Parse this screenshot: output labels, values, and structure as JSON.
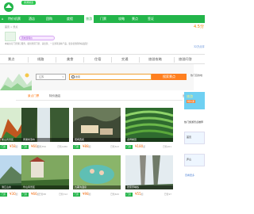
{
  "top": {
    "pill": "旅游频道"
  },
  "nav": [
    "特价机票",
    "酒店",
    "团购",
    "度假",
    "旅游",
    "门票",
    "攻略",
    "景点",
    "签证"
  ],
  "breadcrumb": "首页 > 景点",
  "promo": "周末游特价",
  "desc": "本站主打门票预订服务，提供景区门票、演出票、一日游等多种产品，更多优惠等你来发现！",
  "score": "4.5分",
  "score_count": "32万点评",
  "tabs": [
    "景点",
    "线路",
    "美食",
    "住宿",
    "交通",
    "旅游攻略",
    "旅游问答"
  ],
  "search": {
    "region": "江苏",
    "keyword": "搜索",
    "button": "搜索景点",
    "side": "热门目的地"
  },
  "hotspot": {
    "active": "景点门票",
    "other": "特价酒店",
    "more": "更多 >"
  },
  "cards": [
    {
      "caption": "衡山风景区",
      "tag": "门票",
      "price": "58",
      "unit": "起",
      "stat": "已售356"
    },
    {
      "caption": "黄果树瀑布",
      "tag": "门票",
      "price": "60",
      "unit": "起",
      "stat": "已售1280"
    },
    {
      "caption": "阳朔西街",
      "tag": "门票",
      "price": "88",
      "unit": "起",
      "stat": "已售543"
    },
    {
      "caption": "龙脊梯田",
      "tag": "门票",
      "price": "180",
      "unit": "起",
      "stat": "已售201"
    },
    {
      "caption": "漓江山水",
      "tag": "门票",
      "price": "30",
      "unit": "起",
      "stat": "已售88"
    },
    {
      "caption": "华山风景区",
      "tag": "门票",
      "price": "66",
      "unit": "起",
      "stat": "已售312"
    },
    {
      "caption": "九寨沟温泉",
      "tag": "门票",
      "price": "98",
      "unit": "起",
      "stat": "已售620"
    },
    {
      "caption": "张家界峡谷",
      "tag": "门票",
      "price": "55",
      "unit": "起",
      "stat": "已售97"
    }
  ],
  "right": {
    "ad_title": "旅游",
    "ad_sub": "特价游",
    "recommend": "热门旅游景点推荐",
    "b1": "首页",
    "b2": "庐山",
    "link": "查看更多"
  },
  "colors": {
    "brand": "#23b54a",
    "accent": "#ff7f1f",
    "price": "#f26b10"
  }
}
